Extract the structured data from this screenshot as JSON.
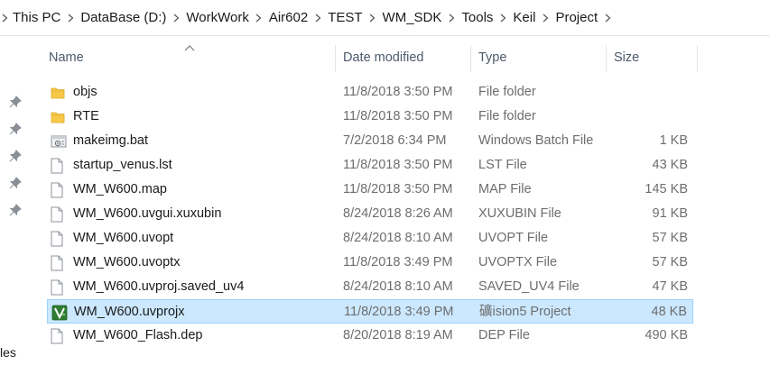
{
  "breadcrumb": [
    "This PC",
    "DataBase (D:)",
    "WorkWork",
    "Air602",
    "TEST",
    "WM_SDK",
    "Tools",
    "Keil",
    "Project"
  ],
  "columns": {
    "name": "Name",
    "date": "Date modified",
    "type": "Type",
    "size": "Size"
  },
  "nav_tail_text": "les",
  "files": [
    {
      "name": "objs",
      "date": "11/8/2018 3:50 PM",
      "type": "File folder",
      "size": "",
      "icon": "folder-icon"
    },
    {
      "name": "RTE",
      "date": "11/8/2018 3:50 PM",
      "type": "File folder",
      "size": "",
      "icon": "folder-icon"
    },
    {
      "name": "makeimg.bat",
      "date": "7/2/2018 6:34 PM",
      "type": "Windows Batch File",
      "size": "1 KB",
      "icon": "batch-file-icon"
    },
    {
      "name": "startup_venus.lst",
      "date": "11/8/2018 3:50 PM",
      "type": "LST File",
      "size": "43 KB",
      "icon": "file-icon"
    },
    {
      "name": "WM_W600.map",
      "date": "11/8/2018 3:50 PM",
      "type": "MAP File",
      "size": "145 KB",
      "icon": "file-icon"
    },
    {
      "name": "WM_W600.uvgui.xuxubin",
      "date": "8/24/2018 8:26 AM",
      "type": "XUXUBIN File",
      "size": "91 KB",
      "icon": "file-icon"
    },
    {
      "name": "WM_W600.uvopt",
      "date": "8/24/2018 8:10 AM",
      "type": "UVOPT File",
      "size": "57 KB",
      "icon": "file-icon"
    },
    {
      "name": "WM_W600.uvoptx",
      "date": "11/8/2018 3:49 PM",
      "type": "UVOPTX File",
      "size": "57 KB",
      "icon": "file-icon"
    },
    {
      "name": "WM_W600.uvproj.saved_uv4",
      "date": "8/24/2018 8:10 AM",
      "type": "SAVED_UV4 File",
      "size": "47 KB",
      "icon": "file-icon"
    },
    {
      "name": "WM_W600.uvprojx",
      "date": "11/8/2018 3:49 PM",
      "type": "礦ision5 Project",
      "size": "48 KB",
      "icon": "keil-project-icon",
      "selected": true
    },
    {
      "name": "WM_W600_Flash.dep",
      "date": "8/20/2018 8:19 AM",
      "type": "DEP File",
      "size": "490 KB",
      "icon": "file-icon"
    }
  ],
  "colors": {
    "selection_bg": "#cce8ff",
    "selection_border": "#99d1ff",
    "folder": "#f7c948",
    "keil_green": "#2e7d32"
  }
}
